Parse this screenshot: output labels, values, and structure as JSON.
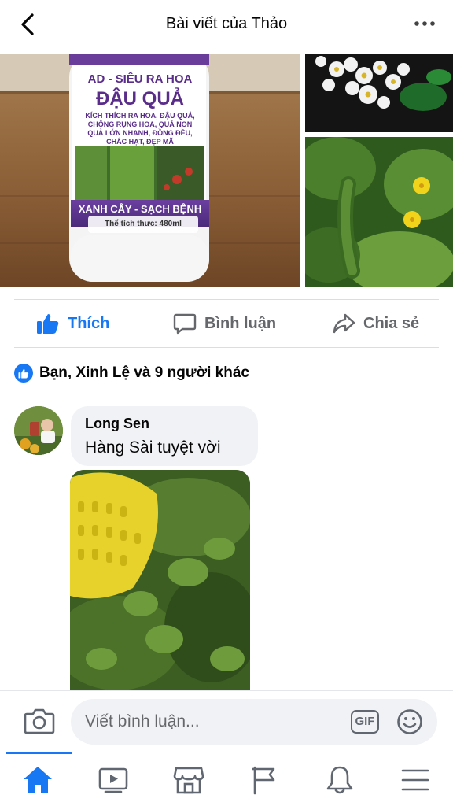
{
  "header": {
    "title": "Bài viết của Thảo",
    "back_icon": "chevron-left-icon",
    "more_icon": "more-horizontal-icon"
  },
  "post_photos": {
    "main": {
      "product_brand": "AD - SIÊU RA HOA",
      "product_name": "ĐẬU QUẢ",
      "product_claims": [
        "KÍCH THÍCH RA HOA, ĐẬU QUẢ,",
        "CHỐNG RỤNG HOA, QUẢ NON",
        "QUẢ LỚN NHANH, ĐỒNG ĐỀU,",
        "CHẮC HẠT, ĐẸP MÃ"
      ],
      "product_banner": "XANH CÂY - SẠCH BỆNH",
      "product_volume": "Thể tích thực: 480ml"
    }
  },
  "actions": {
    "like_label": "Thích",
    "comment_label": "Bình luận",
    "share_label": "Chia sẻ",
    "like_color": "#1877f2"
  },
  "reactions": {
    "summary": "Bạn, Xinh Lệ và 9 người khác"
  },
  "comment": {
    "author": "Long Sen",
    "text": "Hàng Sài tuyệt vời"
  },
  "composer": {
    "placeholder": "Viết bình luận...",
    "gif_label": "GIF"
  },
  "tabbar": {
    "items": [
      {
        "name": "home",
        "icon": "home-icon",
        "active": true
      },
      {
        "name": "watch",
        "icon": "video-icon",
        "active": false
      },
      {
        "name": "marketplace",
        "icon": "store-icon",
        "active": false
      },
      {
        "name": "pages",
        "icon": "flag-icon",
        "active": false
      },
      {
        "name": "notifications",
        "icon": "bell-icon",
        "active": false
      },
      {
        "name": "menu",
        "icon": "menu-icon",
        "active": false
      }
    ]
  }
}
